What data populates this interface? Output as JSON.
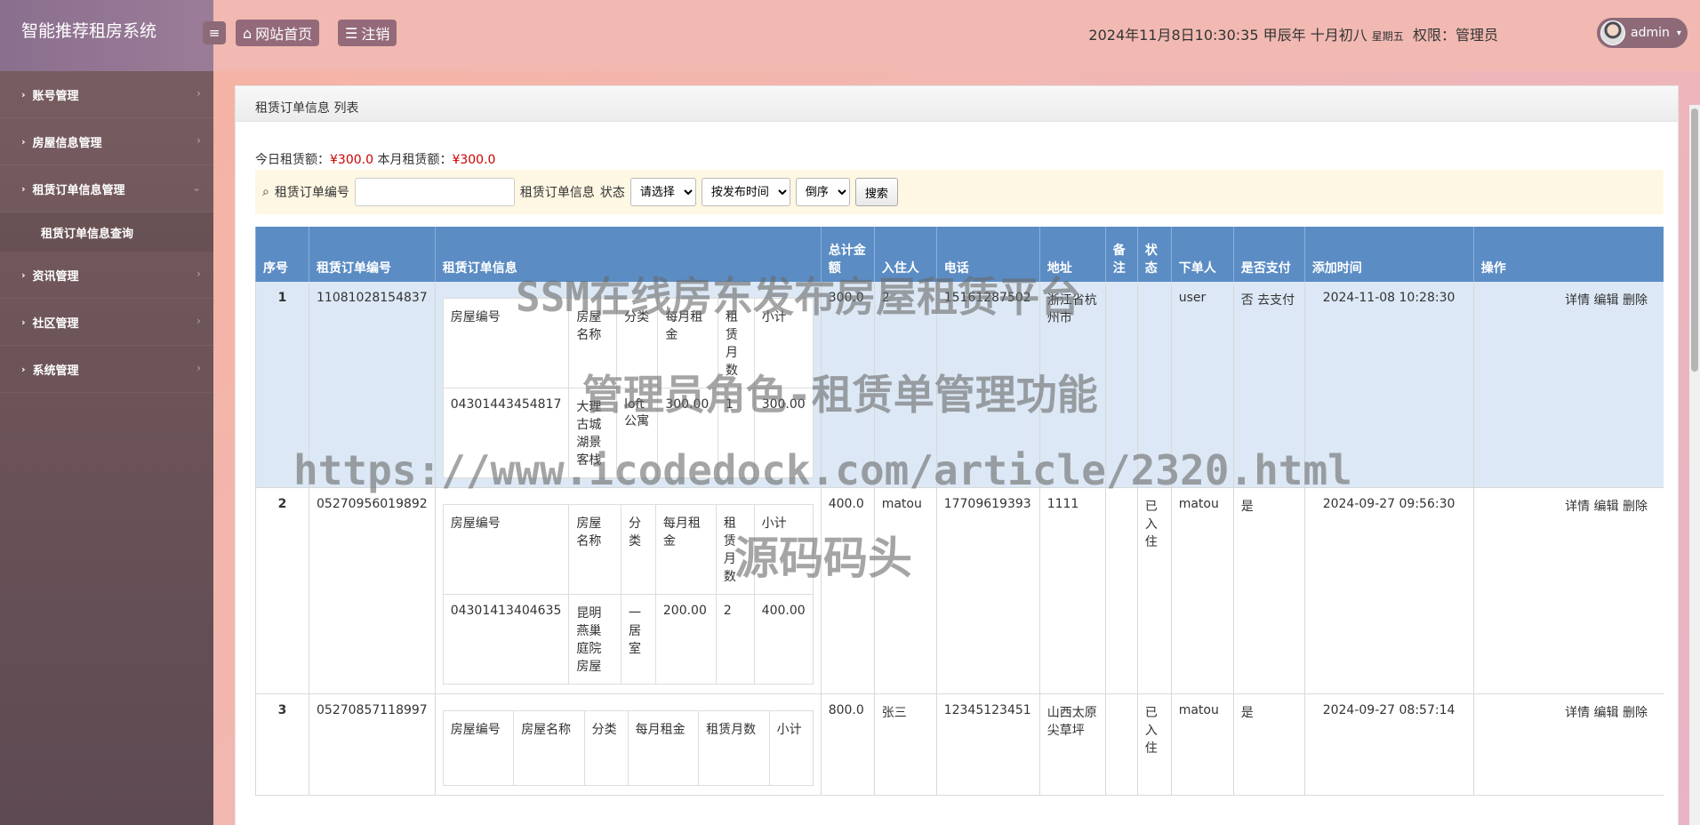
{
  "sidebar": {
    "brand": "智能推荐租房系统",
    "items": [
      {
        "label": "账号管理"
      },
      {
        "label": "房屋信息管理"
      },
      {
        "label": "租赁订单信息管理",
        "sub": "租赁订单信息查询"
      },
      {
        "label": "资讯管理"
      },
      {
        "label": "社区管理"
      },
      {
        "label": "系统管理"
      }
    ]
  },
  "header": {
    "home_label": "网站首页",
    "logout_label": "注销",
    "datetime": "2024年11月8日10:30:35 甲辰年 十月初八",
    "weekday": "星期五",
    "role_text": "权限：管理员",
    "username": "admin"
  },
  "panel": {
    "title": "租赁订单信息 列表",
    "today_label": "今日租赁额：",
    "today_value": "¥300.0",
    "month_label": "本月租赁额：",
    "month_value": "¥300.0"
  },
  "search": {
    "field_label": "租赁订单编号",
    "info_label": "租赁订单信息",
    "status_label": "状态",
    "status_select": "请选择",
    "sort_select": "按发布时间",
    "order_select": "倒序",
    "search_btn": "搜索"
  },
  "table": {
    "headers": [
      "序号",
      "租赁订单编号",
      "租赁订单信息",
      "总计金额",
      "入住人",
      "电话",
      "地址",
      "备注",
      "状态",
      "下单人",
      "是否支付",
      "添加时间",
      "操作"
    ],
    "inner_headers": [
      "房屋编号",
      "房屋名称",
      "分类",
      "每月租金",
      "租赁月数",
      "小计"
    ],
    "actions": {
      "detail": "详情",
      "edit": "编辑",
      "delete": "删除"
    },
    "rows": [
      {
        "sn": "1",
        "order_no": "11081028154837",
        "house_no": "04301443454817",
        "house_name": "大理古城湖景客栈",
        "category": "loft公寓",
        "rent": "300.00",
        "months": "1",
        "subtotal": "300.00",
        "total": "300.0",
        "tenant": "2",
        "phone": "15161287502",
        "address": "浙江省杭州市",
        "remark": "",
        "status": "",
        "buyer": "user",
        "paid": "否",
        "pay_link": "去支付",
        "time": "2024-11-08 10:28:30"
      },
      {
        "sn": "2",
        "order_no": "05270956019892",
        "house_no": "04301413404635",
        "house_name": "昆明燕巢庭院房屋",
        "category": "一居室",
        "rent": "200.00",
        "months": "2",
        "subtotal": "400.00",
        "total": "400.0",
        "tenant": "matou",
        "phone": "17709619393",
        "address": "1111",
        "remark": "",
        "status": "已入住",
        "buyer": "matou",
        "paid": "是",
        "pay_link": "",
        "time": "2024-09-27 09:56:30"
      },
      {
        "sn": "3",
        "order_no": "05270857118997",
        "house_no": "",
        "house_name": "",
        "category": "",
        "rent": "",
        "months": "",
        "subtotal": "",
        "total": "800.0",
        "tenant": "张三",
        "phone": "12345123451",
        "address": "山西太原尖草坪",
        "remark": "",
        "status": "已入住",
        "buyer": "matou",
        "paid": "是",
        "pay_link": "",
        "time": "2024-09-27 08:57:14"
      }
    ]
  },
  "watermark": {
    "line1": "SSM在线房东发布房屋租赁平台",
    "line2": "管理员角色-租赁单管理功能",
    "line3": "https://www.icodedock.com/article/2320.html",
    "line4": "源码码头"
  }
}
